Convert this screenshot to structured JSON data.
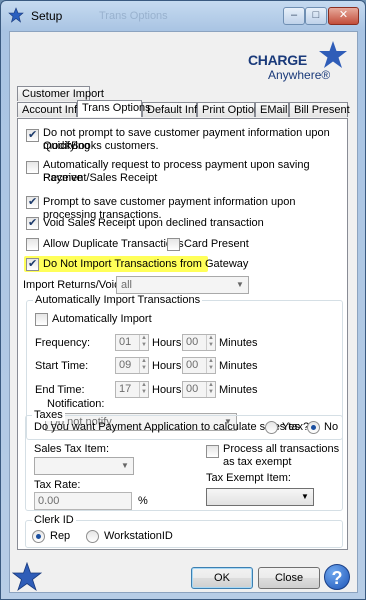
{
  "window": {
    "title": "Setup",
    "ghost_title": "Trans Options",
    "controls": {
      "minimize": "–",
      "maximize": "□",
      "close": "✕"
    }
  },
  "logo": {
    "line1": "CHARGE",
    "line2": "Anywhere®"
  },
  "tabs": {
    "back_row": [
      "Customer Import"
    ],
    "front_row": [
      "Account Info",
      "Trans Options",
      "Default Info",
      "Print Options",
      "EMail",
      "Bill Present"
    ],
    "selected": "Trans Options"
  },
  "options": {
    "no_prompt_save": {
      "label_line1": "Do not prompt to save customer payment information upon modifying",
      "label_line2": "QuickBooks customers.",
      "checked": true
    },
    "auto_request": {
      "label_line1": "Automatically request to process payment upon saving Receive",
      "label_line2": "Payment/Sales Receipt",
      "checked": false
    },
    "prompt_save": {
      "label": "Prompt to save customer payment information upon processing transactions.",
      "checked": true
    },
    "void_receipt": {
      "label": "Void Sales Receipt upon declined transaction",
      "checked": true
    },
    "allow_duplicate": {
      "label": "Allow Duplicate Transactions",
      "checked": false
    },
    "card_present": {
      "label": "Card Present",
      "checked": false
    },
    "no_import": {
      "label": "Do Not Import Transactions from Gateway",
      "checked": true
    }
  },
  "import_returns": {
    "label": "Import Returns/Voids",
    "value": "all"
  },
  "auto_import": {
    "group_title": "Automatically Import Transactions",
    "checkbox_label": "Automatically Import",
    "checked": false,
    "frequency": {
      "label": "Frequency:",
      "hours": "01",
      "minutes": "00"
    },
    "start_time": {
      "label": "Start Time:",
      "hours": "09",
      "minutes": "00"
    },
    "end_time": {
      "label": "End Time:",
      "hours": "17",
      "minutes": "00"
    },
    "hours_label": "Hours",
    "minutes_label": "Minutes",
    "notification": {
      "label": "Notification:",
      "value": "Do not notify"
    }
  },
  "taxes": {
    "group_title": "Taxes",
    "question": "Do you want Payment Application to calculate sales tax?",
    "yes_label": "Yes",
    "no_label": "No",
    "selected": "No",
    "sales_tax_item_label": "Sales Tax Item:",
    "sales_tax_item_value": "",
    "tax_rate_label": "Tax Rate:",
    "tax_rate_value": "0.00",
    "percent": "%",
    "process_all": {
      "line1": "Process all transactions",
      "line2": "as tax exempt",
      "checked": false
    },
    "tax_exempt_item_label": "Tax Exempt Item:",
    "tax_exempt_item_value": ""
  },
  "clerk": {
    "group_title": "Clerk ID",
    "rep_label": "Rep",
    "workstation_label": "WorkstationID",
    "selected": "Rep"
  },
  "buttons": {
    "ok": "OK",
    "close": "Close",
    "help": "?"
  }
}
